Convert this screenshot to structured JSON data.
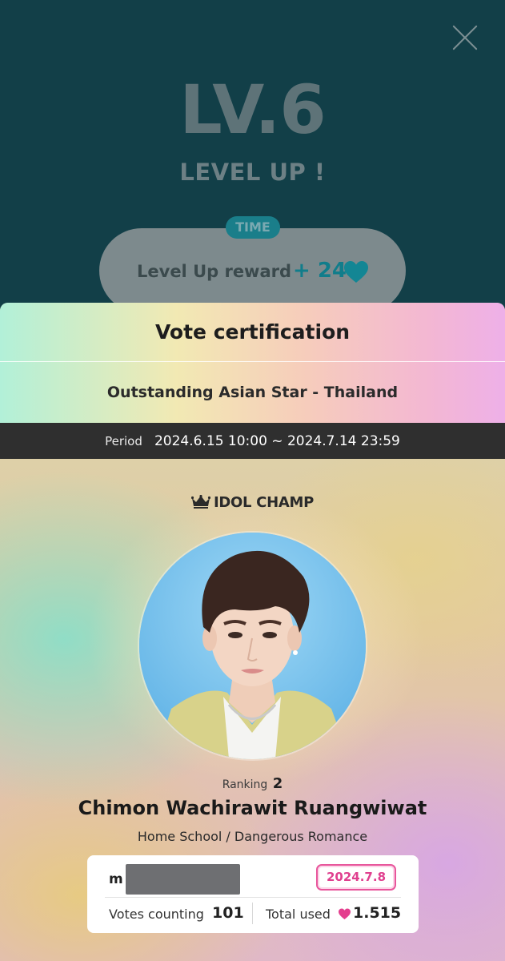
{
  "background": {
    "level_title": "LV.6",
    "level_up_text": "LEVEL UP !",
    "time_badge": "TIME",
    "reward_label": "Level Up reward",
    "reward_amount": "+ 24",
    "reward_icon": "heart-icon"
  },
  "card": {
    "title": "Vote certification",
    "subtitle": "Outstanding Asian Star - Thailand",
    "period_label": "Period",
    "period_value": "2024.6.15 10:00 ~ 2024.7.14 23:59",
    "brand": "IDOL CHAMP",
    "brand_icon": "crown-icon",
    "ranking_label": "Ranking",
    "ranking_value": "2",
    "idol_name": "Chimon Wachirawit Ruangwiwat",
    "idol_works": "Home School / Dangerous Romance",
    "user_id_visible": "m",
    "date": "2024.7.8",
    "votes_label": "Votes counting",
    "votes_value": "101",
    "total_label": "Total used",
    "total_value": "1.515",
    "total_icon": "heart-icon"
  },
  "colors": {
    "teal_bg": "#123f48",
    "accent_teal": "#117d8b",
    "accent_pink": "#e0408f",
    "period_bar": "#2f2f2f"
  }
}
